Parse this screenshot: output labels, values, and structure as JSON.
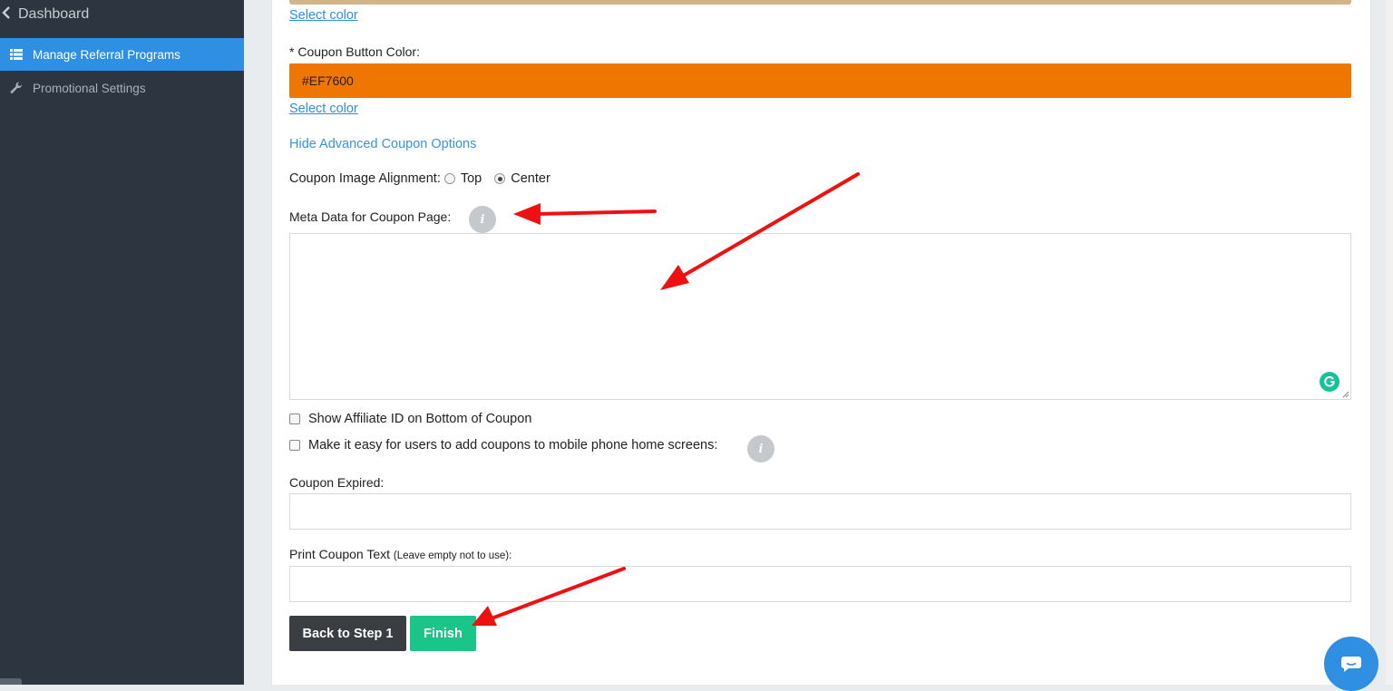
{
  "sidebar": {
    "back_label": "Dashboard",
    "items": [
      {
        "label": "Manage Referral Programs",
        "icon": "list-icon",
        "active": true
      },
      {
        "label": "Promotional Settings",
        "icon": "wrench-icon",
        "active": false
      }
    ]
  },
  "form": {
    "select_color_label_1": "Select color",
    "coupon_button_color_label": "* Coupon Button Color:",
    "coupon_button_color_value": "#EF7600",
    "select_color_label_2": "Select color",
    "hide_advanced_label": "Hide Advanced Coupon Options",
    "image_alignment_label": "Coupon Image Alignment:",
    "alignment_options": [
      {
        "label": "Top",
        "selected": false
      },
      {
        "label": "Center",
        "selected": true
      }
    ],
    "meta_data_label": "Meta Data for Coupon Page:",
    "meta_data_value": "",
    "show_affiliate_label": "Show Affiliate ID on Bottom of Coupon",
    "mobile_home_label": "Make it easy for users to add coupons to mobile phone home screens:",
    "coupon_expired_label": "Coupon Expired:",
    "coupon_expired_value": "",
    "print_text_label": "Print Coupon Text",
    "print_text_hint": "(Leave empty not to use):",
    "print_text_value": "",
    "info_glyph": "i"
  },
  "buttons": {
    "back_label": "Back to Step 1",
    "finish_label": "Finish"
  },
  "colors": {
    "accent": "#2f8fe3",
    "coupon_button": "#EF7600",
    "finish": "#1bc488",
    "sidebar": "#2c3540",
    "annotation_arrow": "#ee1111"
  }
}
